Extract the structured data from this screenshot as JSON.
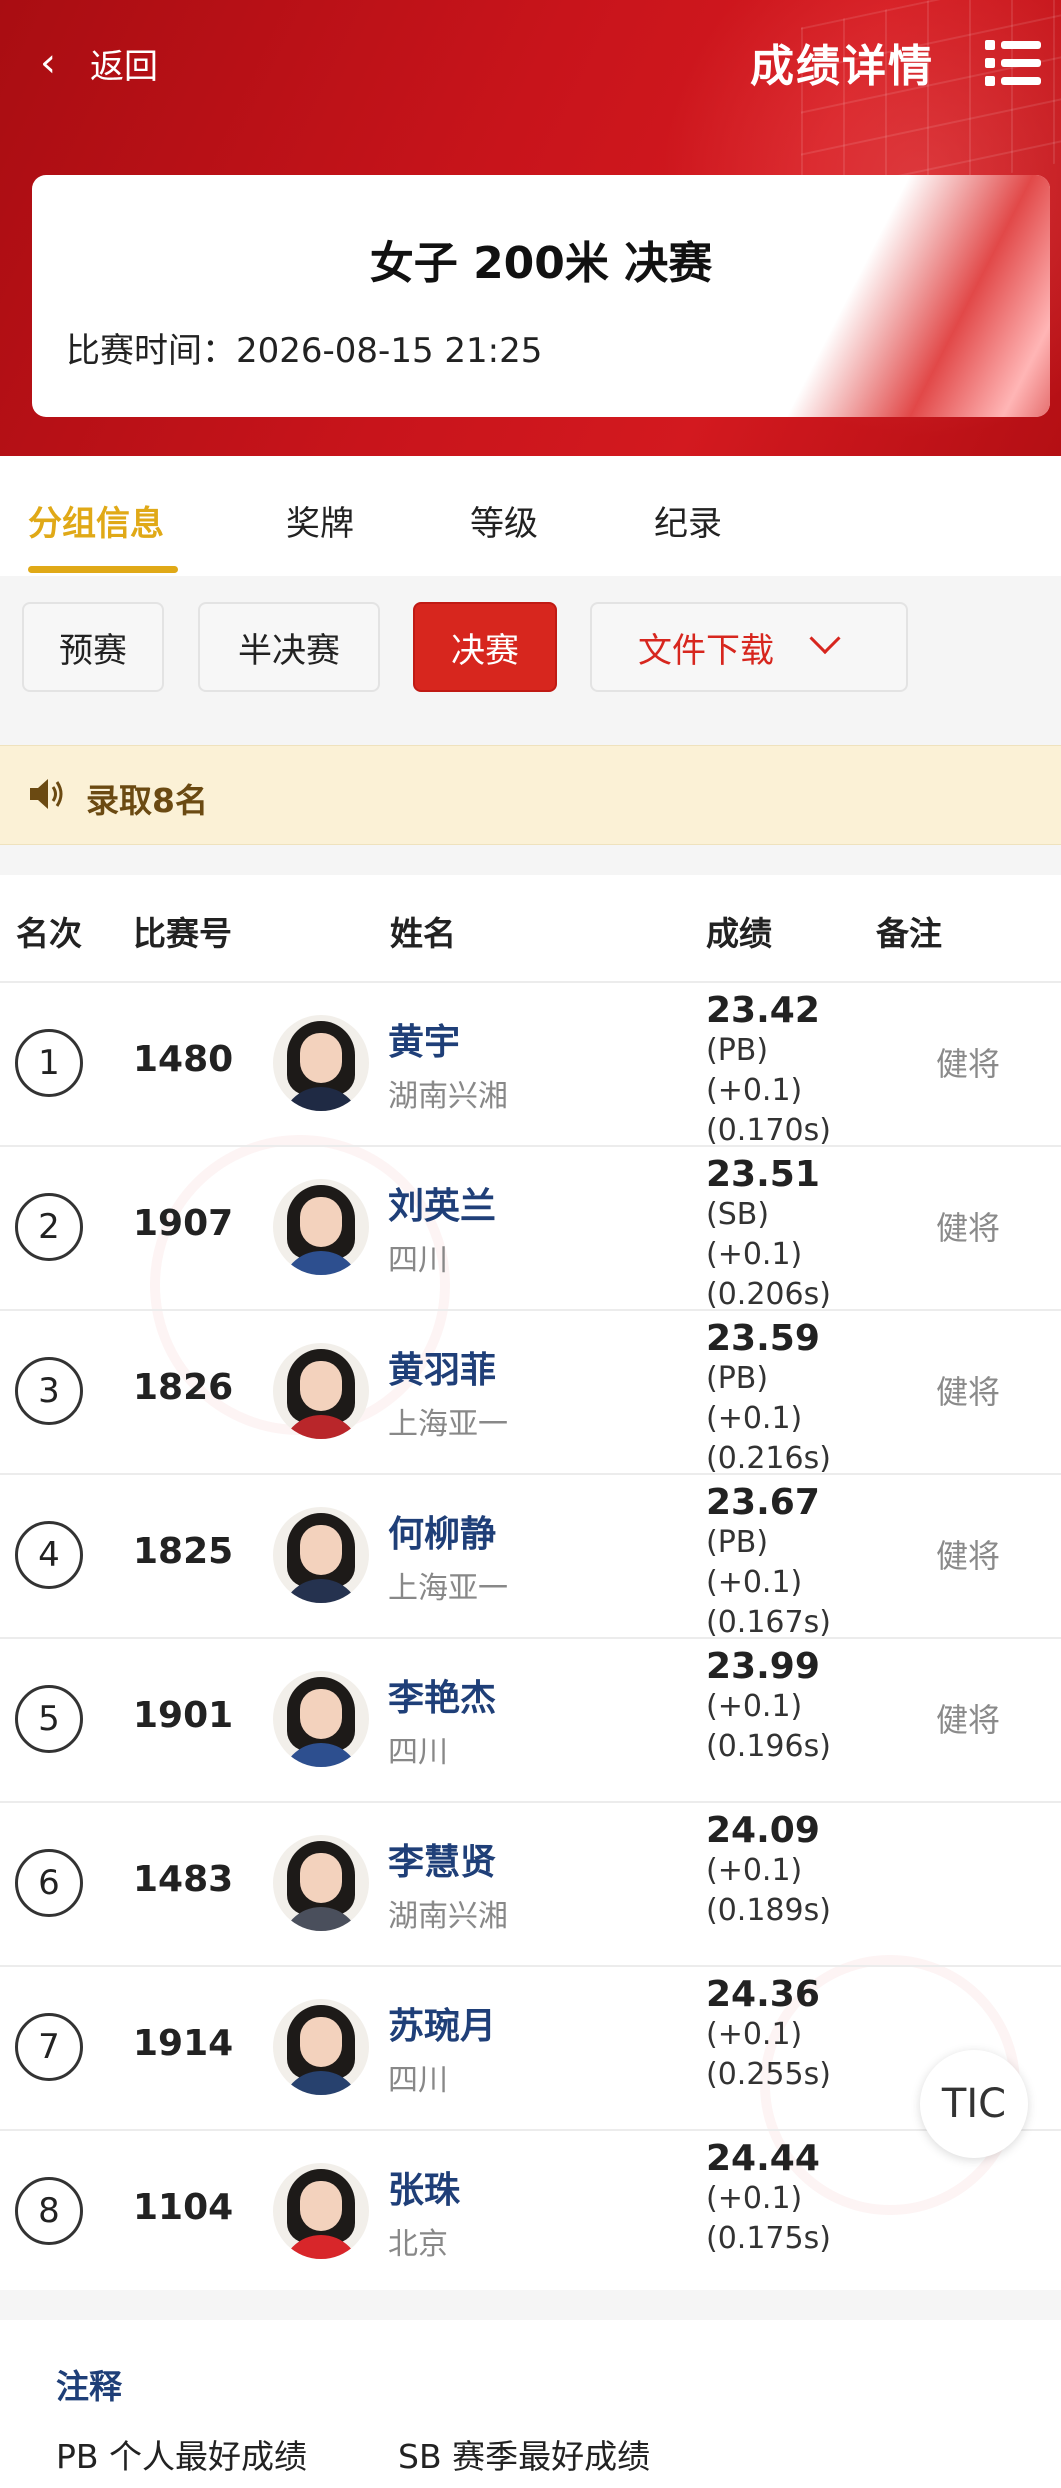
{
  "header": {
    "back_label": "返回",
    "title": "成绩详情"
  },
  "event": {
    "title": "女子 200米 决赛",
    "time": "比赛时间：2026-08-15  21:25"
  },
  "tabs": [
    {
      "label": "分组信息",
      "active": true
    },
    {
      "label": "奖牌",
      "active": false
    },
    {
      "label": "等级",
      "active": false
    },
    {
      "label": "纪录",
      "active": false
    }
  ],
  "rounds": [
    {
      "label": "预赛",
      "active": false
    },
    {
      "label": "半决赛",
      "active": false
    },
    {
      "label": "决赛",
      "active": true
    }
  ],
  "download": {
    "label": "文件下载"
  },
  "notice": {
    "text": "录取8名"
  },
  "table": {
    "headers": {
      "rank": "名次",
      "bib": "比赛号",
      "name": "姓名",
      "result": "成绩",
      "remark": "备注"
    },
    "rows": [
      {
        "rank": "1",
        "bib": "1480",
        "name": "黄宇",
        "team": "湖南兴湘",
        "time": "23.42",
        "details": [
          "(PB)",
          "(+0.1)",
          "(0.170s)"
        ],
        "remark": "健将",
        "shirt": "#1f2a44"
      },
      {
        "rank": "2",
        "bib": "1907",
        "name": "刘英兰",
        "team": "四川",
        "time": "23.51",
        "details": [
          "(SB)",
          "(+0.1)",
          "(0.206s)"
        ],
        "remark": "健将",
        "shirt": "#2d4f8f"
      },
      {
        "rank": "3",
        "bib": "1826",
        "name": "黄羽菲",
        "team": "上海亚一",
        "time": "23.59",
        "details": [
          "(PB)",
          "(+0.1)",
          "(0.216s)"
        ],
        "remark": "健将",
        "shirt": "#b9262a"
      },
      {
        "rank": "4",
        "bib": "1825",
        "name": "何柳静",
        "team": "上海亚一",
        "time": "23.67",
        "details": [
          "(PB)",
          "(+0.1)",
          "(0.167s)"
        ],
        "remark": "健将",
        "shirt": "#25324f"
      },
      {
        "rank": "5",
        "bib": "1901",
        "name": "李艳杰",
        "team": "四川",
        "time": "23.99",
        "details": [
          "(+0.1)",
          "(0.196s)"
        ],
        "remark": "健将",
        "shirt": "#2d4f8f"
      },
      {
        "rank": "6",
        "bib": "1483",
        "name": "李慧贤",
        "team": "湖南兴湘",
        "time": "24.09",
        "details": [
          "(+0.1)",
          "(0.189s)"
        ],
        "remark": "",
        "shirt": "#4a4f5c"
      },
      {
        "rank": "7",
        "bib": "1914",
        "name": "苏琬月",
        "team": "四川",
        "time": "24.36",
        "details": [
          "(+0.1)",
          "(0.255s)"
        ],
        "remark": "",
        "shirt": "#27416e"
      },
      {
        "rank": "8",
        "bib": "1104",
        "name": "张珠",
        "team": "北京",
        "time": "24.44",
        "details": [
          "(+0.1)",
          "(0.175s)"
        ],
        "remark": "",
        "shirt": "#d8262a"
      }
    ]
  },
  "floating_button": {
    "label": "TIC"
  },
  "notes": {
    "title": "注释",
    "items": [
      "PB 个人最好成绩",
      "SB 赛季最好成绩"
    ]
  },
  "colors": {
    "brand_red": "#d7261e",
    "tab_active": "#e0a917",
    "name_blue": "#1f3f78",
    "notice_bg": "#fbf1d6"
  }
}
